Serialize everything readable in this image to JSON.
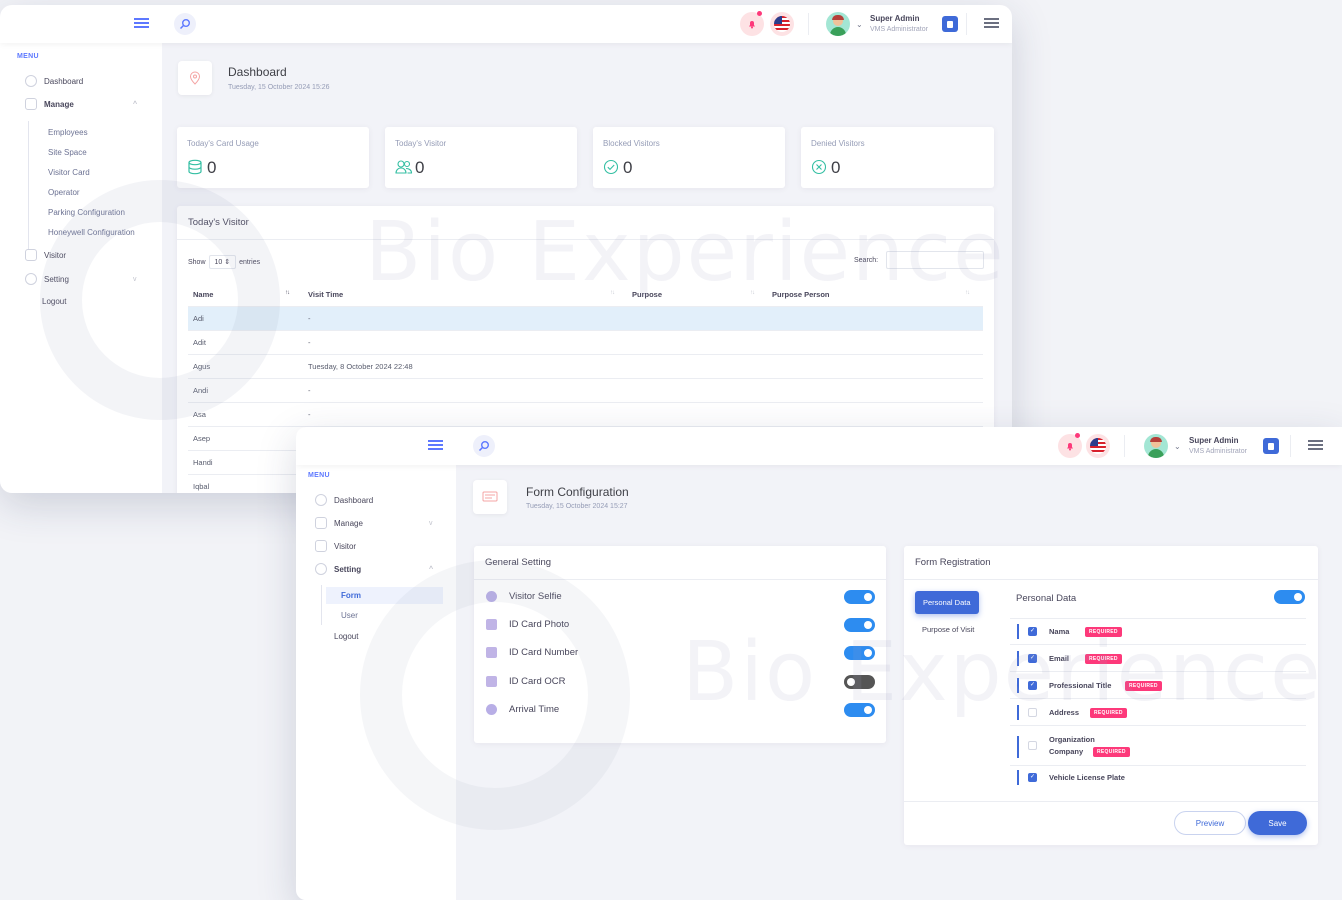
{
  "watermark": "Bio Experience",
  "topbar": {
    "user_name": "Super Admin",
    "user_role": "VMS Administrator"
  },
  "menu": {
    "title": "MENU",
    "dashboard": "Dashboard",
    "manage": "Manage",
    "manage_sub": [
      "Employees",
      "Site Space",
      "Visitor Card",
      "Operator",
      "Parking Configuration",
      "Honeywell Configuration"
    ],
    "visitor": "Visitor",
    "setting": "Setting",
    "setting_sub": [
      "Form",
      "User"
    ],
    "logout": "Logout"
  },
  "dashboard": {
    "title": "Dashboard",
    "date": "Tuesday, 15 October 2024 15:26",
    "stats": [
      {
        "label": "Today's Card Usage",
        "value": "0",
        "icon": "database-icon",
        "color": "#34bfa3"
      },
      {
        "label": "Today's Visitor",
        "value": "0",
        "icon": "users-icon",
        "color": "#34bfa3"
      },
      {
        "label": "Blocked Visitors",
        "value": "0",
        "icon": "check-circle-icon",
        "color": "#34bfa3"
      },
      {
        "label": "Denied Visitors",
        "value": "0",
        "icon": "x-circle-icon",
        "color": "#34bfa3"
      }
    ],
    "table": {
      "title": "Today's Visitor",
      "show": "Show",
      "entries_value": "10",
      "entries": "entries",
      "search_label": "Search:",
      "columns": [
        "Name",
        "Visit Time",
        "Purpose",
        "Purpose Person"
      ],
      "rows": [
        [
          "Adi",
          "-"
        ],
        [
          "Adit",
          "-"
        ],
        [
          "Agus",
          "Tuesday, 8 October 2024 22:48"
        ],
        [
          "Andi",
          "-"
        ],
        [
          "Asa",
          "-"
        ],
        [
          "Asep",
          "-"
        ],
        [
          "Handi",
          "-"
        ],
        [
          "Iqbal",
          "-"
        ]
      ]
    }
  },
  "form_config": {
    "title": "Form Configuration",
    "date": "Tuesday, 15 October 2024 15:27",
    "general": {
      "title": "General Setting",
      "items": [
        {
          "label": "Visitor Selfie",
          "on": true
        },
        {
          "label": "ID Card Photo",
          "on": true
        },
        {
          "label": "ID Card Number",
          "on": true
        },
        {
          "label": "ID Card OCR",
          "on": false
        },
        {
          "label": "Arrival Time",
          "on": true
        }
      ]
    },
    "registration": {
      "title": "Form Registration",
      "tabs": [
        "Personal Data",
        "Purpose of Visit"
      ],
      "section_title": "Personal Data",
      "required_label": "REQUIRED",
      "fields": [
        {
          "label": "Nama",
          "checked": true,
          "required": true
        },
        {
          "label": "Email",
          "checked": true,
          "required": true
        },
        {
          "label": "Professional Title",
          "checked": true,
          "required": true
        },
        {
          "label": "Address",
          "checked": false,
          "required": true
        },
        {
          "label": "Organization",
          "label2": "Company",
          "checked": false,
          "required": true
        },
        {
          "label": "Vehicle License Plate",
          "checked": true,
          "required": false
        }
      ],
      "preview": "Preview",
      "save": "Save"
    }
  }
}
